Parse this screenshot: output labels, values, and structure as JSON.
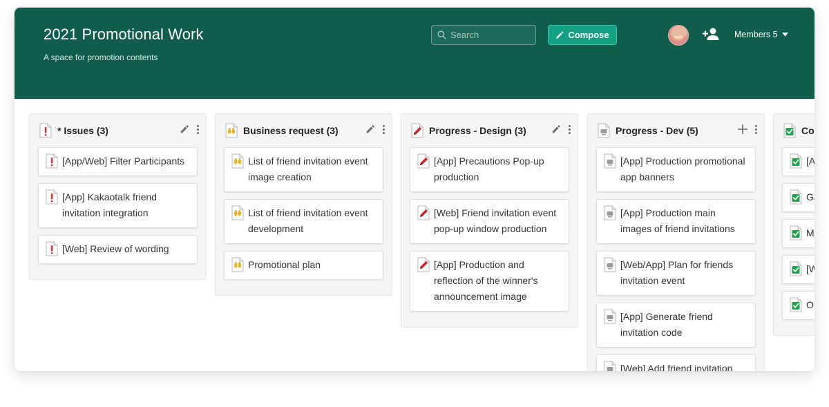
{
  "header": {
    "title": "2021 Promotional Work",
    "subtitle": "A space for promotion contents",
    "search_placeholder": "Search",
    "compose_label": "Compose",
    "members_label": "Members 5"
  },
  "colors": {
    "header_bg": "#115d4c",
    "compose_bg": "#14a083",
    "issue_red": "#d6312f",
    "request_yellow": "#f2b21b",
    "design_red": "#d01f22",
    "dev_gray": "#9a9a9a",
    "done_green": "#1aa64a"
  },
  "columns": [
    {
      "title": "* Issues (3)",
      "icon": "issue-icon",
      "action": "edit",
      "cards": [
        "[App/Web] Filter Participants",
        "[App] Kakaotalk friend invitation integration",
        "[Web] Review of wording"
      ]
    },
    {
      "title": "Business request (3)",
      "icon": "request-icon",
      "action": "edit",
      "cards": [
        "List of friend invitation event image creation",
        "List of friend invitation event development",
        "Promotional plan"
      ]
    },
    {
      "title": "Progress - Design (3)",
      "icon": "design-icon",
      "action": "edit",
      "cards": [
        "[App] Precautions Pop-up production",
        "[Web] Friend invitation event pop-up window production",
        "[App] Production and reflection of the winner's announcement image"
      ]
    },
    {
      "title": "Progress - Dev (5)",
      "icon": "dev-icon",
      "action": "add",
      "cards": [
        "[App] Production promotional app banners",
        "[App] Production main images of friend invitations",
        "[Web/App] Plan for friends invitation event",
        "[App] Generate friend invitation code",
        "[Web] Add friend invitation"
      ]
    },
    {
      "title": "Co",
      "icon": "done-icon",
      "action": "none",
      "cards": [
        "[A be",
        "Ga",
        "M",
        "[W ba",
        "O"
      ]
    }
  ]
}
